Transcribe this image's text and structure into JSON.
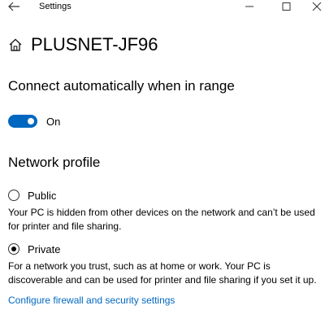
{
  "window": {
    "title": "Settings"
  },
  "network": {
    "ssid": "PLUSNET-JF96"
  },
  "auto_connect": {
    "heading": "Connect automatically when in range",
    "toggle_label": "On",
    "state": "on"
  },
  "profile": {
    "heading": "Network profile",
    "options": [
      {
        "label": "Public",
        "selected": false,
        "description": "Your PC is hidden from other devices on the network and can’t be used for printer and file sharing."
      },
      {
        "label": "Private",
        "selected": true,
        "description": "For a network you trust, such as at home or work. Your PC is discoverable and can be used for printer and file sharing if you set it up."
      }
    ]
  },
  "links": {
    "firewall": "Configure firewall and security settings"
  },
  "colors": {
    "accent": "#0067c0"
  },
  "icons": [
    "back-arrow-icon",
    "minimize-icon",
    "maximize-icon",
    "close-icon",
    "home-icon"
  ]
}
